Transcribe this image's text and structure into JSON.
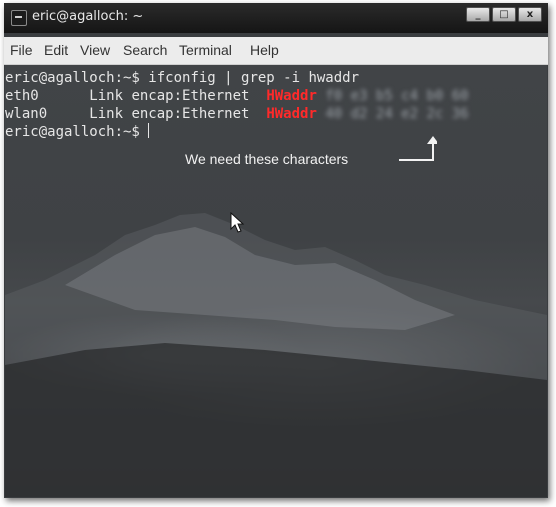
{
  "window": {
    "title": "eric@agalloch: ~",
    "buttons": [
      "_",
      "□",
      "x"
    ]
  },
  "menubar": {
    "items": [
      "File",
      "Edit",
      "View",
      "Search",
      "Terminal",
      "Help"
    ]
  },
  "terminal": {
    "lines": [
      {
        "prompt": "eric@agalloch:~$ ",
        "command": "ifconfig | grep -i hwaddr"
      },
      {
        "iface": "eth0      ",
        "text": "Link encap:Ethernet  ",
        "hw": "HWaddr",
        "mac": " f0 e3 b5 c4 b0 60"
      },
      {
        "iface": "wlan0     ",
        "text": "Link encap:Ethernet  ",
        "hw": "HWaddr",
        "mac": " 40 d2 24 e2 2c 36"
      },
      {
        "prompt": "eric@agalloch:~$ ",
        "command": ""
      }
    ]
  },
  "annotation": {
    "text": "We need these characters"
  },
  "colors": {
    "hwaddr": "#ff2a2a",
    "terminal_text": "#e6e6e6",
    "menubar_bg": "#ececec",
    "titlebar_bg": "#1e1e1e"
  }
}
